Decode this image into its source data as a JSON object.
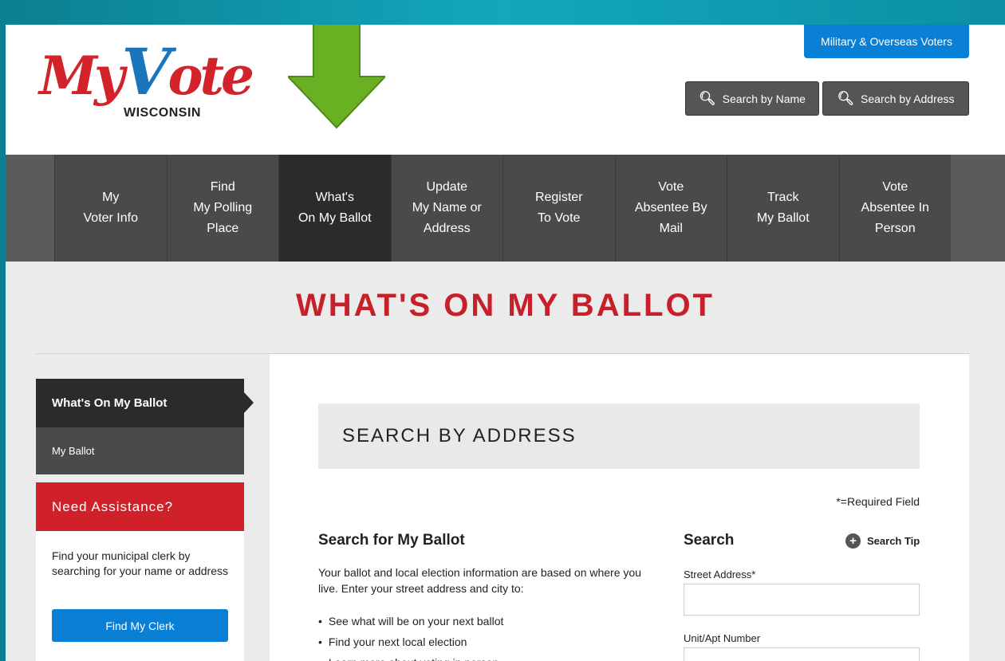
{
  "logo": {
    "script_left": "My",
    "script_v": "V",
    "script_right": "ote",
    "state": "WISCONSIN"
  },
  "header": {
    "military_label": "Military & Overseas Voters",
    "search_name_label": "Search by Name",
    "search_address_label": "Search by Address"
  },
  "nav": {
    "items": [
      {
        "label": "My\nVoter Info"
      },
      {
        "label": "Find\nMy Polling\nPlace"
      },
      {
        "label": "What's\nOn My Ballot"
      },
      {
        "label": "Update\nMy Name or\nAddress"
      },
      {
        "label": "Register\nTo Vote"
      },
      {
        "label": "Vote\nAbsentee By\nMail"
      },
      {
        "label": "Track\nMy Ballot"
      },
      {
        "label": "Vote\nAbsentee In\nPerson"
      }
    ],
    "active_index": 2
  },
  "page_title": "WHAT'S ON MY BALLOT",
  "sidebar": {
    "active_label": "What's On My Ballot",
    "sub_label": "My Ballot",
    "assist_heading": "Need Assistance?",
    "assist_text": "Find your municipal clerk by searching for your name or address",
    "clerk_button": "Find My Clerk"
  },
  "main": {
    "section_title": "SEARCH BY ADDRESS",
    "required_note": "*=Required Field",
    "left_heading": "Search for My Ballot",
    "left_desc": "Your ballot and local election information are based on where you live. Enter your street address and city to:",
    "bullets": [
      "See what will be on your next ballot",
      "Find your next local election",
      "Learn more about voting in person"
    ],
    "right_heading": "Search",
    "search_tip": "Search Tip",
    "street_label": "Street Address*",
    "street_value": "",
    "unit_label": "Unit/Apt Number",
    "unit_value": ""
  },
  "colors": {
    "brand_red": "#d0202a",
    "brand_blue": "#0a7fd6",
    "arrow_green": "#6ab023",
    "nav_dark": "#2b2b2b"
  }
}
